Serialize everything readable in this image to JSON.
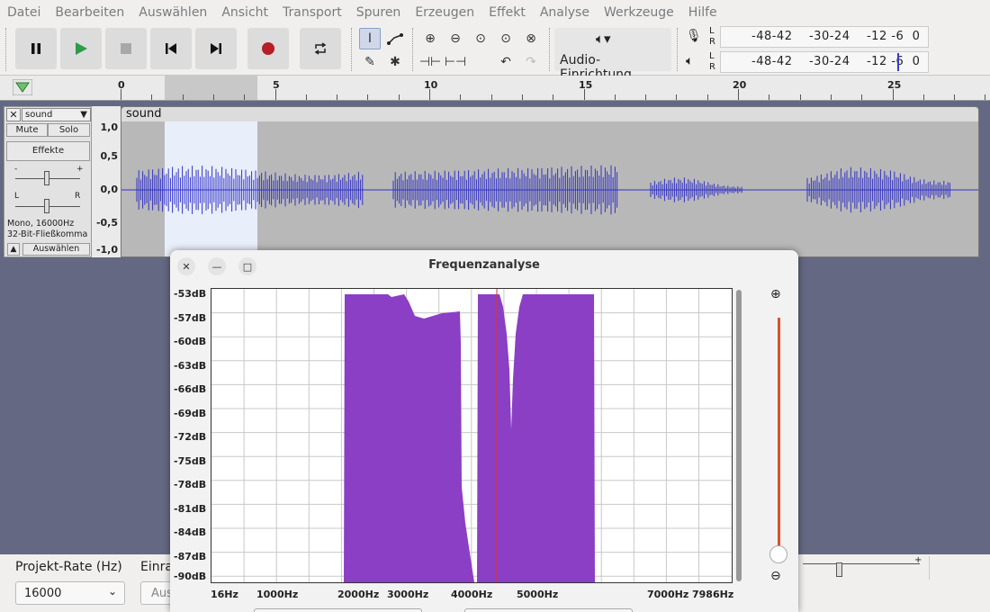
{
  "menu": [
    "Datei",
    "Bearbeiten",
    "Auswählen",
    "Ansicht",
    "Transport",
    "Spuren",
    "Erzeugen",
    "Effekt",
    "Analyse",
    "Werkzeuge",
    "Hilfe"
  ],
  "toolbar": {
    "transport": [
      "pause-icon",
      "play-icon",
      "stop-icon",
      "skip-start-icon",
      "skip-end-icon",
      "record-icon",
      "loop-icon"
    ],
    "audio_setup_label": "Audio-Einrichtung",
    "meter_scale": "-48-42    -30-24    -12 -6  0",
    "meter_L": "L",
    "meter_R": "R"
  },
  "ruler": {
    "labels": [
      "0",
      "5",
      "10",
      "15",
      "20",
      "25"
    ]
  },
  "track": {
    "name": "sound",
    "title": "sound",
    "mute": "Mute",
    "solo": "Solo",
    "effects": "Effekte",
    "gain_minus": "-",
    "gain_plus": "+",
    "pan_left": "L",
    "pan_right": "R",
    "format_line1": "Mono, 16000Hz",
    "format_line2": "32-Bit-Fließkomma",
    "select": "Auswählen",
    "vscale": [
      "1,0",
      "0,5",
      "0,0",
      "-0,5",
      "-1,0"
    ]
  },
  "dialog": {
    "title": "Frequenzanalyse",
    "db_labels": [
      "-53dB",
      "-57dB",
      "-60dB",
      "-63dB",
      "-66dB",
      "-69dB",
      "-72dB",
      "-75dB",
      "-78dB",
      "-81dB",
      "-84dB",
      "-87dB",
      "-90dB"
    ],
    "hz_labels": [
      "16Hz",
      "1000Hz",
      "2000Hz",
      "3000Hz",
      "4000Hz",
      "5000Hz",
      "7000Hz",
      "7986Hz"
    ],
    "zoom_level": 0.05
  },
  "bottom": {
    "project_rate_label": "Projekt-Rate (Hz)",
    "project_rate_value": "16000",
    "snap_label": "Einra",
    "snap_value": "Aus"
  },
  "colors": {
    "spectrum": "#8a3fc4",
    "waveform": "#3232c8",
    "cursor": "#e0302a",
    "selection": "#e8eefa"
  }
}
